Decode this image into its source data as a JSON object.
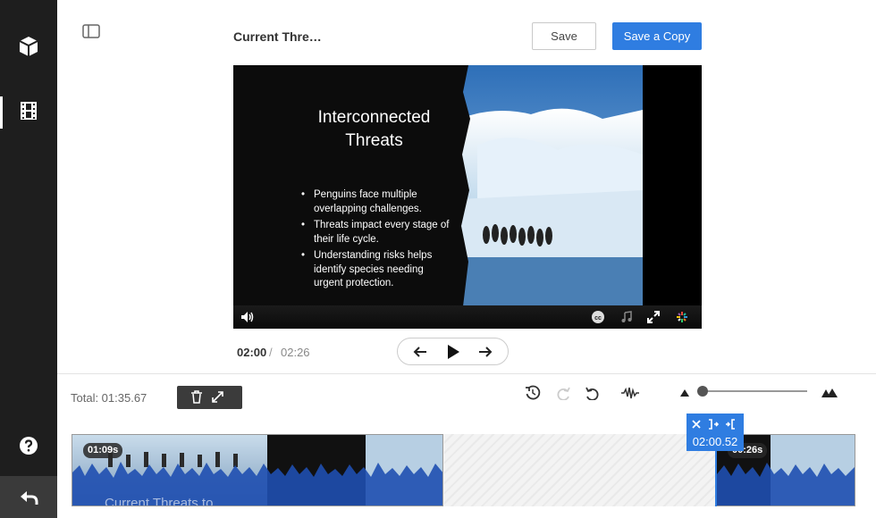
{
  "header": {
    "project_title": "Current Thre…",
    "save_label": "Save",
    "save_copy_label": "Save a Copy"
  },
  "slide": {
    "title": "Interconnected Threats",
    "bullets": [
      "Penguins face multiple overlapping challenges.",
      "Threats impact every stage of their life cycle.",
      "Understanding risks helps identify species needing urgent protection."
    ]
  },
  "player": {
    "current_time": "02:00",
    "separator": "/",
    "total_time": "02:26"
  },
  "timeline": {
    "total_label": "Total: 01:35.67",
    "clips": [
      {
        "duration": "01:09s",
        "overlay_text": "Current Threats to"
      },
      {
        "duration": "00:26s"
      }
    ],
    "playhead_time": "02:00.52"
  },
  "colors": {
    "accent": "#2f7de1",
    "rail": "#1e1e1e"
  },
  "icons": [
    "cube-icon",
    "filmstrip-icon",
    "help-icon",
    "undo-icon",
    "layout-toggle-icon",
    "volume-icon",
    "closed-captions-icon",
    "music-icon",
    "fullscreen-icon",
    "brand-icon",
    "arrow-left-icon",
    "play-icon",
    "arrow-right-icon",
    "trash-icon",
    "expand-icon",
    "rewind-icon",
    "redo-icon",
    "undo-icon",
    "waveform-icon",
    "zoom-out-icon",
    "zoom-in-icon",
    "cut-icon",
    "trim-start-icon",
    "trim-end-icon"
  ]
}
